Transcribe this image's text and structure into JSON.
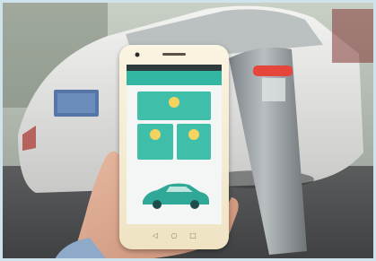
{
  "scene": {
    "description_colors": {
      "background": "#6c6f70",
      "accent": "#33b7a4",
      "phone": "#f1e6c9",
      "post": "#9aa0a4",
      "led": "#e6453b",
      "frame": "#cfe3ec"
    }
  },
  "phone": {
    "status_time": "",
    "app_title": "",
    "tiles": [
      {
        "label": ""
      },
      {
        "label": ""
      },
      {
        "label": ""
      }
    ],
    "car_caption": ""
  }
}
